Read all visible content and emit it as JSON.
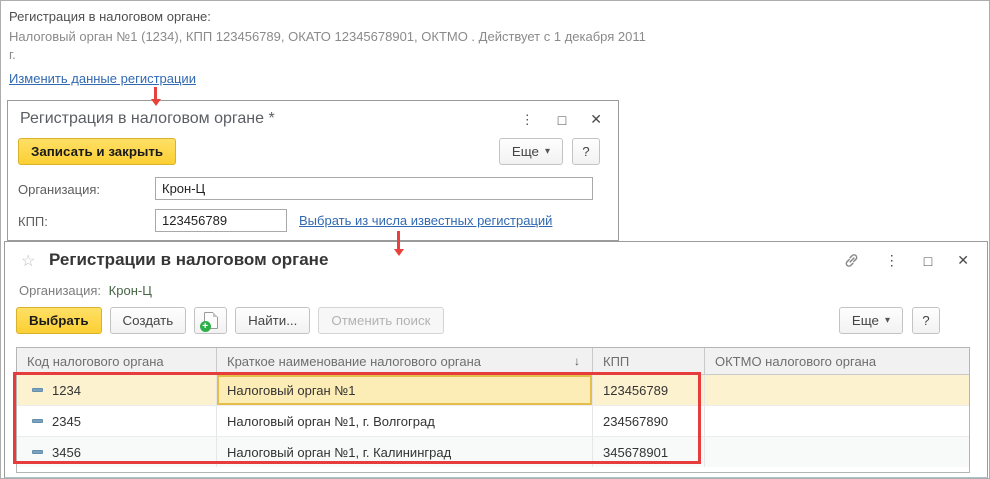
{
  "icons": {
    "menu": "⋮",
    "maximize": "□",
    "close": "✕",
    "star": "☆",
    "dropdown": "▾",
    "sort_desc": "↓",
    "create_group_plus": "+",
    "help": "?"
  },
  "background": {
    "heading": "Регистрация в налоговом органе:",
    "description": "Налоговый орган №1 (1234), КПП 123456789, ОКАТО 12345678901, ОКТМО . Действует с 1 декабря 2011 г.",
    "change_link": "Изменить данные регистрации"
  },
  "dialog": {
    "title": "Регистрация в налоговом органе *",
    "save_close_button": "Записать и закрыть",
    "more_button": "Еще",
    "org_label": "Организация:",
    "org_value": "Крон-Ц",
    "kpp_label": "КПП:",
    "kpp_value": "123456789",
    "choose_link": "Выбрать из числа известных регистраций"
  },
  "list_window": {
    "title": "Регистрации в налоговом органе",
    "org_label": "Организация:",
    "org_value": "Крон-Ц",
    "toolbar": {
      "select_button": "Выбрать",
      "create_button": "Создать",
      "find_button": "Найти...",
      "cancel_search_button": "Отменить поиск",
      "more_button": "Еще"
    },
    "table": {
      "columns": {
        "code": "Код налогового органа",
        "name": "Краткое наименование налогового органа",
        "kpp": "КПП",
        "oktmo": "ОКТМО налогового органа"
      },
      "sorted_by": "Краткое наименование налогового органа",
      "rows": [
        {
          "code": "1234",
          "name": "Налоговый орган №1",
          "kpp": "123456789",
          "oktmo": ""
        },
        {
          "code": "2345",
          "name": "Налоговый орган №1, г. Волгоград",
          "kpp": "234567890",
          "oktmo": ""
        },
        {
          "code": "3456",
          "name": "Налоговый орган №1, г. Калининград",
          "kpp": "345678901",
          "oktmo": ""
        }
      ]
    }
  },
  "colors": {
    "accent_yellow": "#fccf33",
    "selected_row": "#fdf2cf",
    "active_cell_border": "#e4bd4a",
    "link_blue": "#3169b2",
    "annotation_red": "#e63c3c",
    "org_value_green": "#456545"
  }
}
